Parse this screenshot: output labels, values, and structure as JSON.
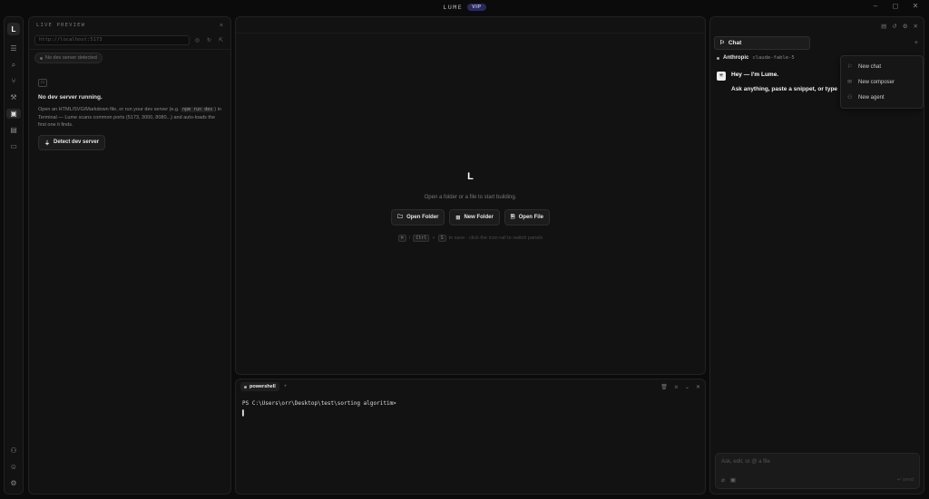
{
  "titlebar": {
    "brand": "LUME",
    "badge": "VIP",
    "minimize": "–",
    "maximize": "◻",
    "close": "✕"
  },
  "rail": {
    "logo": "L"
  },
  "live_preview": {
    "title": "LIVE PREVIEW",
    "close": "×",
    "url_placeholder": "http://localhost:5173",
    "status_pill": "No dev server detected",
    "heading": "No dev server running.",
    "desc_1": "Open an HTML/SVG/Markdown file, or run your dev server (e.g. ",
    "desc_code": "npm run dev",
    "desc_2": ") in Terminal — Lume scans common ports (5173, 3000, 8080...) and auto-loads the first one it finds.",
    "detect_button": "Detect dev server"
  },
  "center": {
    "logo": "L",
    "message": "Open a folder or a file to start building.",
    "buttons": {
      "open_folder": "Open Folder",
      "new_folder": "New Folder",
      "open_file": "Open File"
    },
    "hint": {
      "key1": "⌘",
      "slash": "/",
      "key2": "Ctrl",
      "plus": "+",
      "key3": "S",
      "text": "to save · click the icon rail to switch panels"
    }
  },
  "terminal": {
    "tab": "powershell",
    "add": "+",
    "lines": [
      "PS C:\\Users\\orr\\Desktop\\test\\sorting algoritim>",
      "▌"
    ]
  },
  "chat": {
    "tab": "Chat",
    "add": "+",
    "provider": "Anthropic",
    "model": "claude-fable-5",
    "greeting": "Hey — I'm Lume.",
    "prompt": "Ask anything, paste a snippet, or type",
    "menu": [
      "New chat",
      "New composer",
      "New agent"
    ],
    "composer_placeholder": "Ask, edit, or @ a file",
    "send": "↵ send"
  }
}
